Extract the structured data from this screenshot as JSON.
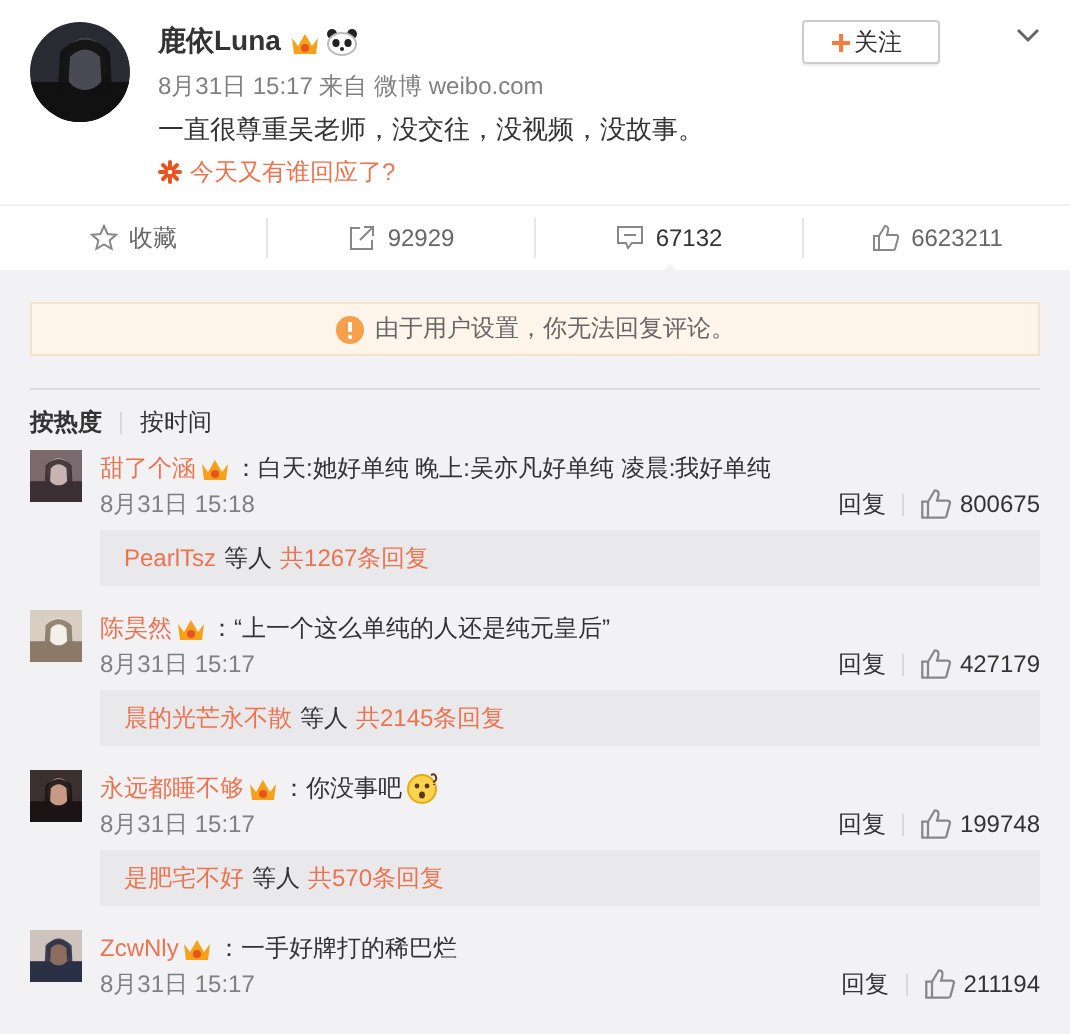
{
  "post": {
    "author": "鹿依Luna",
    "follow": "关注",
    "meta": "8月31日 15:17 来自 微博 weibo.com",
    "text": "一直很尊重吴老师，没交往，没视频，没故事。",
    "topic": "今天又有谁回应了?"
  },
  "actions": [
    {
      "kind": "favorite",
      "label": "收藏",
      "selected": false
    },
    {
      "kind": "repost",
      "label": "92929",
      "selected": false
    },
    {
      "kind": "comment",
      "label": "67132",
      "selected": true
    },
    {
      "kind": "like",
      "label": "6623211",
      "selected": false
    }
  ],
  "notice": "由于用户设置，你无法回复评论。",
  "sort_tabs": [
    {
      "label": "按热度",
      "selected": true
    },
    {
      "label": "按时间",
      "selected": false
    }
  ],
  "comments": [
    {
      "user": "甜了个涵",
      "text": "：白天:她好单纯 晚上:吴亦凡好单纯 凌晨:我好单纯",
      "emoji": false,
      "time": "8月31日 15:18",
      "reply": "回复",
      "likes": "800675",
      "replies": {
        "names": "PearlTsz",
        "joiner": "等人",
        "total": "共1267条回复"
      }
    },
    {
      "user": "陈昊然",
      "text": "：“上一个这么单纯的人还是纯元皇后”",
      "emoji": false,
      "time": "8月31日 15:17",
      "reply": "回复",
      "likes": "427179",
      "replies": {
        "names": "晨的光芒永不散",
        "joiner": "等人",
        "total": "共2145条回复"
      }
    },
    {
      "user": "永远都睡不够",
      "text": "：你没事吧",
      "emoji": true,
      "time": "8月31日 15:17",
      "reply": "回复",
      "likes": "199748",
      "replies": {
        "names": "是肥宅不好",
        "joiner": "等人",
        "total": "共570条回复"
      }
    },
    {
      "user": "ZcwNly",
      "text": "：一手好牌打的稀巴烂",
      "emoji": false,
      "time": "8月31日 15:17",
      "reply": "回复",
      "likes": "211194"
    }
  ]
}
